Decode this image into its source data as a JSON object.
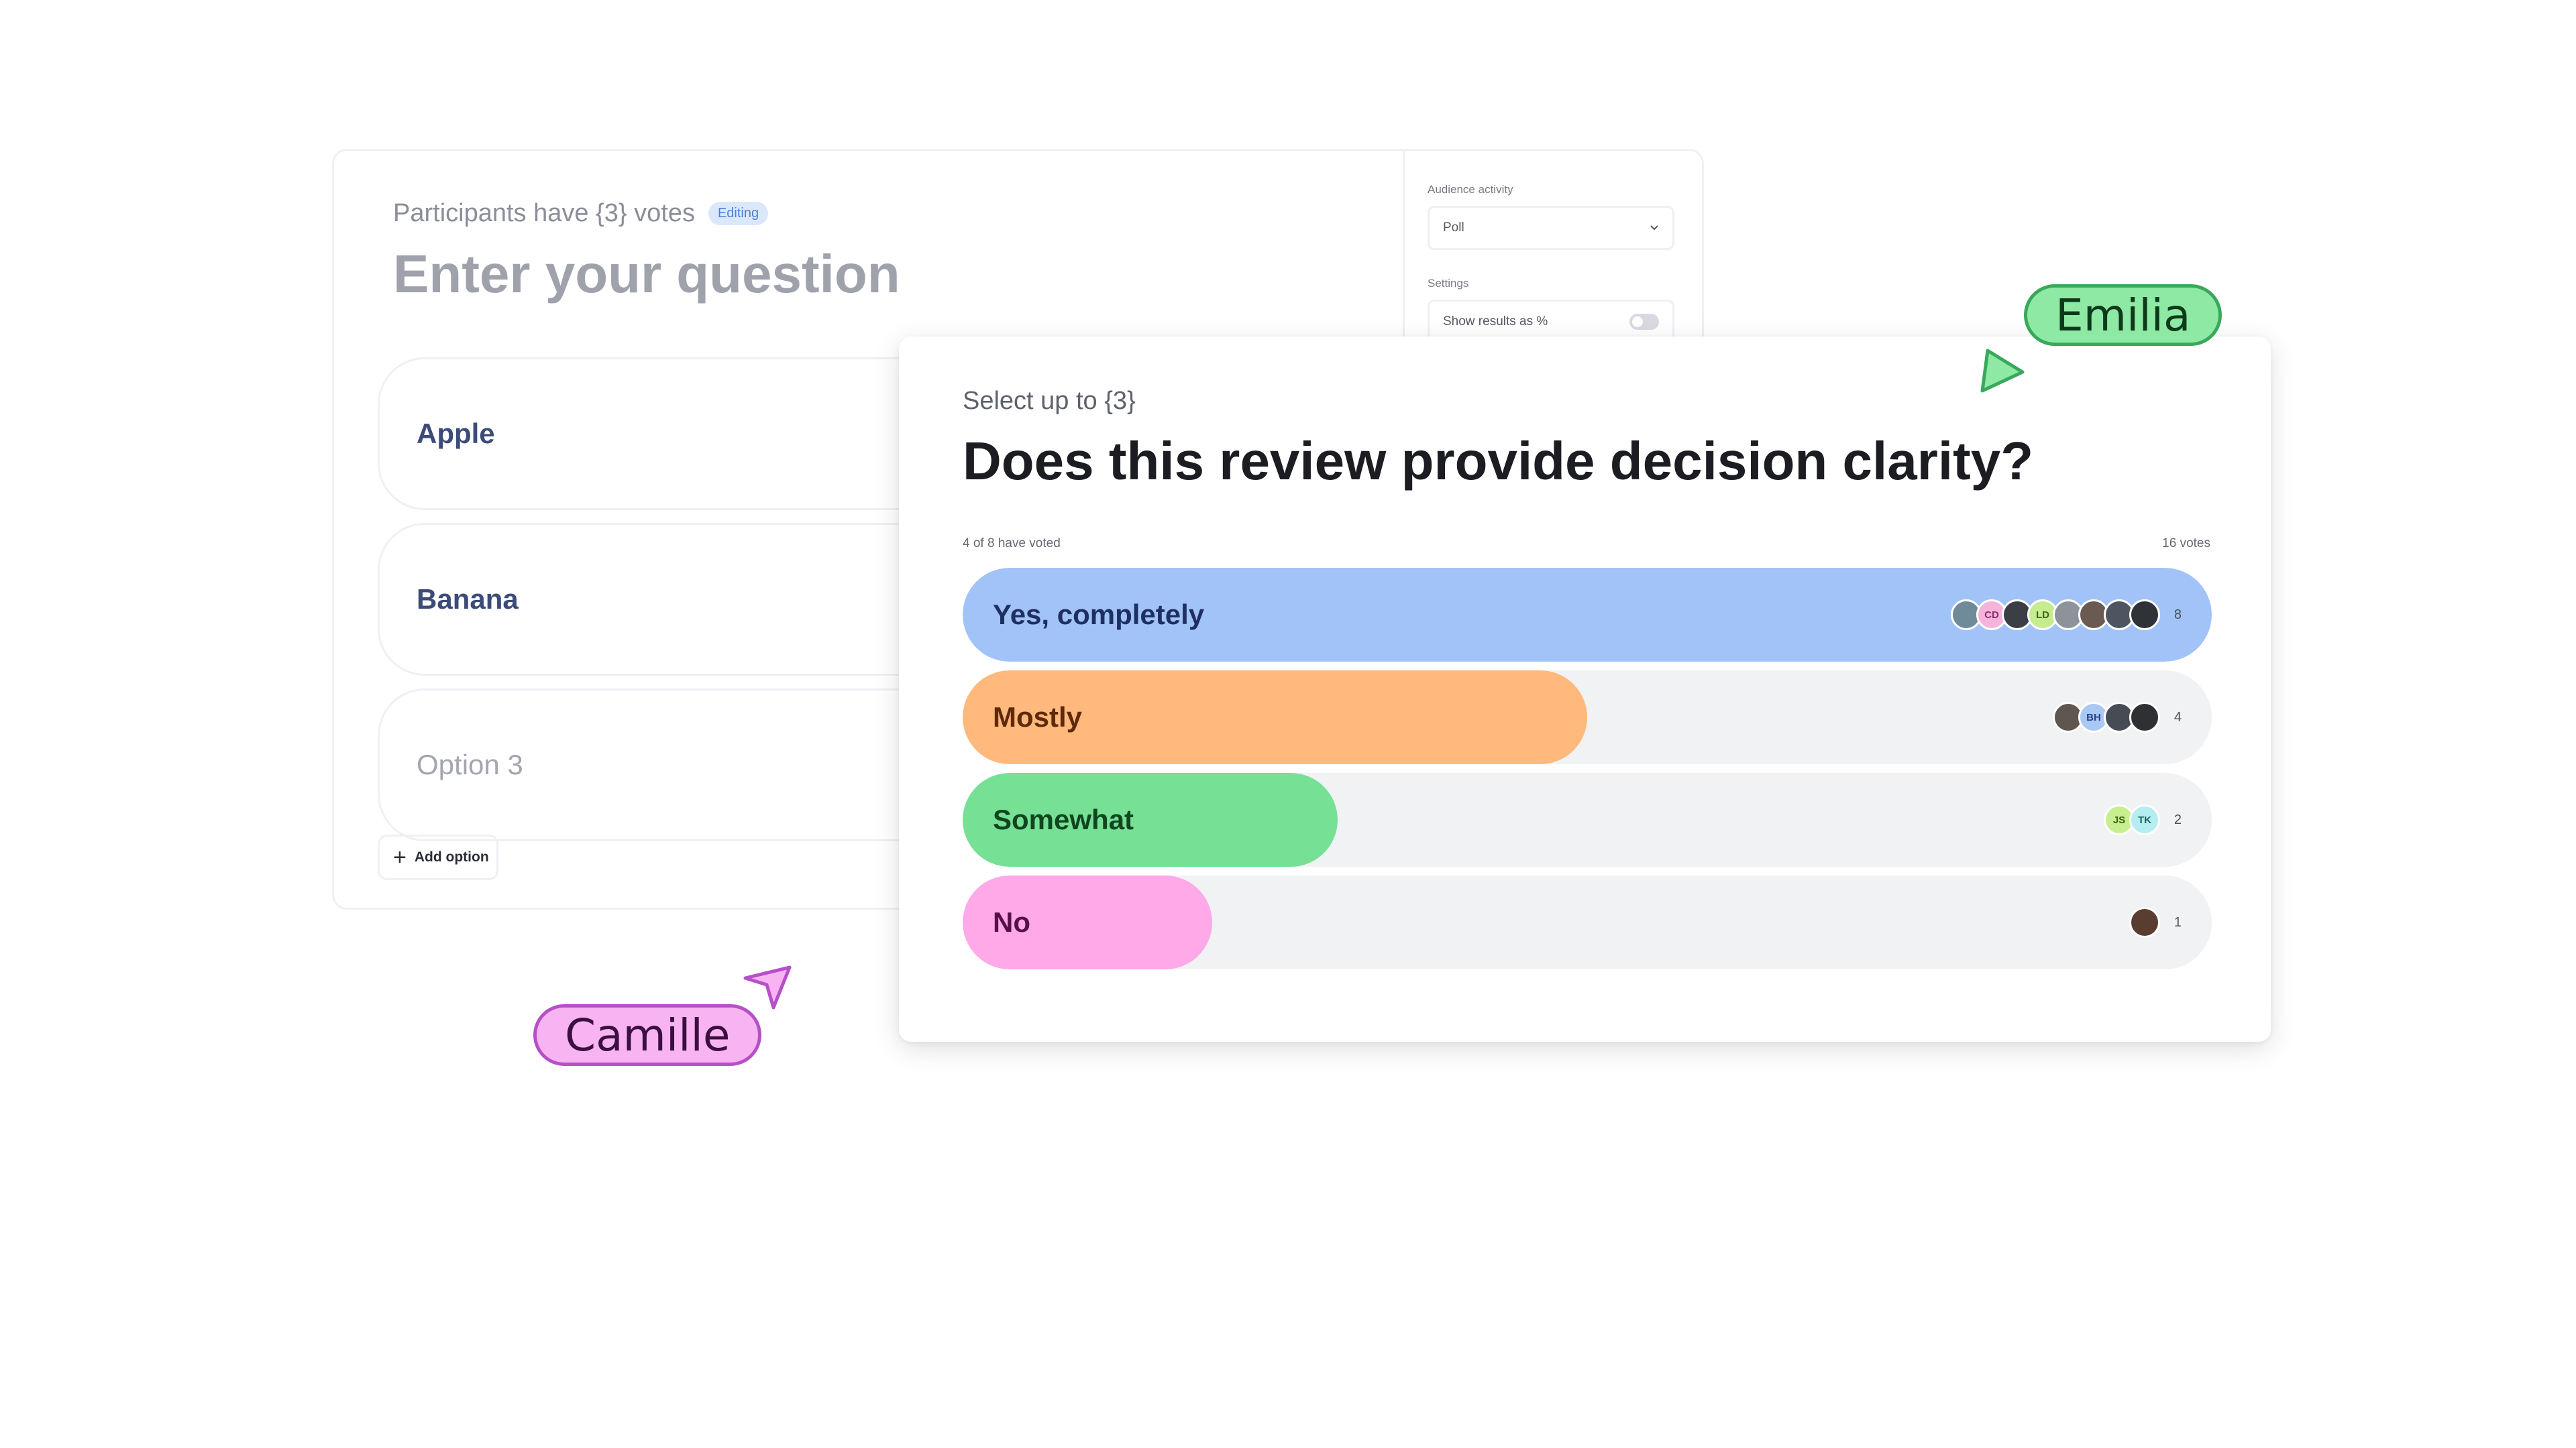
{
  "editor": {
    "participants_label": "Participants have {3} votes",
    "editing_badge": "Editing",
    "question_placeholder": "Enter your question",
    "options": [
      "Apple",
      "Banana",
      "Option 3"
    ],
    "add_option_label": "Add option",
    "panel": {
      "audience_activity_label": "Audience activity",
      "activity_value": "Poll",
      "settings_label": "Settings",
      "show_results_label": "Show results as %",
      "show_results_enabled": false
    }
  },
  "result": {
    "select_label": "Select up to {3}",
    "question": "Does this review provide decision clarity?",
    "voted_text": "4 of 8 have voted",
    "total_votes": "16 votes",
    "options": [
      {
        "label": "Yes, completely",
        "count": "8",
        "fraction": 1.0,
        "fill": "#a1c3f7",
        "text_color": "#1f2f63",
        "avatars": [
          {
            "initials": "",
            "bg": "#6f8a99",
            "fg": "#fff"
          },
          {
            "initials": "CD",
            "bg": "#f6b3dc",
            "fg": "#8a2d6b"
          },
          {
            "initials": "",
            "bg": "#3b3f45",
            "fg": "#fff"
          },
          {
            "initials": "LD",
            "bg": "#c5ec8e",
            "fg": "#3f6413"
          },
          {
            "initials": "",
            "bg": "#8d939b",
            "fg": "#fff"
          },
          {
            "initials": "",
            "bg": "#6b5a52",
            "fg": "#fff"
          },
          {
            "initials": "",
            "bg": "#4d5560",
            "fg": "#fff"
          },
          {
            "initials": "",
            "bg": "#2f3236",
            "fg": "#fff"
          }
        ]
      },
      {
        "label": "Mostly",
        "count": "4",
        "fraction": 0.5,
        "fill": "#ffb97c",
        "text_color": "#5e2a09",
        "avatars": [
          {
            "initials": "",
            "bg": "#5f5650",
            "fg": "#fff"
          },
          {
            "initials": "BH",
            "bg": "#a9c8f5",
            "fg": "#27408a"
          },
          {
            "initials": "",
            "bg": "#474c54",
            "fg": "#fff"
          },
          {
            "initials": "",
            "bg": "#2e3034",
            "fg": "#fff"
          }
        ]
      },
      {
        "label": "Somewhat",
        "count": "2",
        "fraction": 0.3,
        "fill": "#76e095",
        "text_color": "#11451f",
        "avatars": [
          {
            "initials": "JS",
            "bg": "#c7ef8f",
            "fg": "#3d6012"
          },
          {
            "initials": "TK",
            "bg": "#b4eef0",
            "fg": "#1e6268"
          }
        ]
      },
      {
        "label": "No",
        "count": "1",
        "fraction": 0.2,
        "fill": "#ffa9e8",
        "text_color": "#571047",
        "avatars": [
          {
            "initials": "",
            "bg": "#5a3d31",
            "fg": "#fff"
          }
        ]
      }
    ]
  },
  "cursors": {
    "emilia": {
      "name": "Emilia",
      "color": "#3aa85a",
      "bg": "#8ee9a5",
      "text": "#0d3a1a"
    },
    "camille": {
      "name": "Camille",
      "color": "#b64fc8",
      "bg": "#f8b4f2",
      "text": "#3b0f3f"
    }
  }
}
